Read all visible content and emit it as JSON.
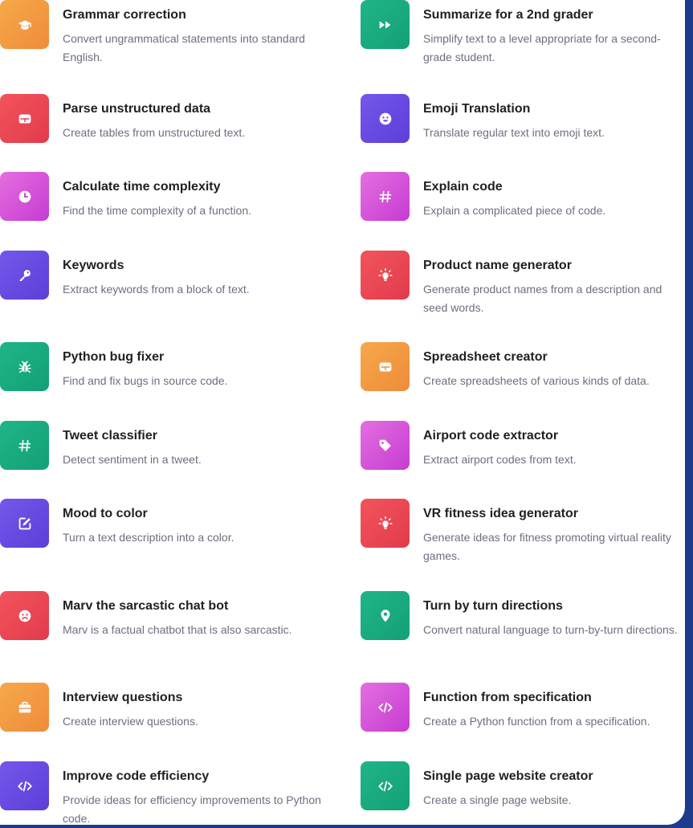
{
  "examples": [
    {
      "title": "Grammar correction",
      "desc": "Convert ungrammatical statements into standard English.",
      "icon": "graduation-cap-icon",
      "color": "#f09a43"
    },
    {
      "title": "Summarize for a 2nd grader",
      "desc": "Simplify text to a level appropriate for a second-grade student.",
      "icon": "fast-forward-icon",
      "color": "#19a97e"
    },
    {
      "title": "Parse unstructured data",
      "desc": "Create tables from unstructured text.",
      "icon": "table-icon",
      "color": "#ea4654"
    },
    {
      "title": "Emoji Translation",
      "desc": "Translate regular text into emoji text.",
      "icon": "smiley-face-icon",
      "color": "#6249df"
    },
    {
      "title": "Calculate time complexity",
      "desc": "Find the time complexity of a function.",
      "icon": "clock-icon",
      "color": "#d454d9"
    },
    {
      "title": "Explain code",
      "desc": "Explain a complicated piece of code.",
      "icon": "hashtag-icon",
      "color": "#d454d9"
    },
    {
      "title": "Keywords",
      "desc": "Extract keywords from a block of text.",
      "icon": "key-icon",
      "color": "#6249df"
    },
    {
      "title": "Product name generator",
      "desc": "Generate product names from a description and seed words.",
      "icon": "lightbulb-icon",
      "color": "#ea4654"
    },
    {
      "title": "Python bug fixer",
      "desc": "Find and fix bugs in source code.",
      "icon": "bug-icon",
      "color": "#19a97e"
    },
    {
      "title": "Spreadsheet creator",
      "desc": "Create spreadsheets of various kinds of data.",
      "icon": "table-icon",
      "color": "#f09a43"
    },
    {
      "title": "Tweet classifier",
      "desc": "Detect sentiment in a tweet.",
      "icon": "hashtag-icon",
      "color": "#19a97e"
    },
    {
      "title": "Airport code extractor",
      "desc": "Extract airport codes from text.",
      "icon": "tag-icon",
      "color": "#d454d9"
    },
    {
      "title": "Mood to color",
      "desc": "Turn a text description into a color.",
      "icon": "edit-icon",
      "color": "#6249df"
    },
    {
      "title": "VR fitness idea generator",
      "desc": "Generate ideas for fitness promoting virtual reality games.",
      "icon": "lightbulb-icon",
      "color": "#ea4654"
    },
    {
      "title": "Marv the sarcastic chat bot",
      "desc": "Marv is a factual chatbot that is also sarcastic.",
      "icon": "frown-face-icon",
      "color": "#ea4654"
    },
    {
      "title": "Turn by turn directions",
      "desc": "Convert natural language to turn-by-turn directions.",
      "icon": "map-pin-icon",
      "color": "#19a97e"
    },
    {
      "title": "Interview questions",
      "desc": "Create interview questions.",
      "icon": "briefcase-icon",
      "color": "#f09a43"
    },
    {
      "title": "Function from specification",
      "desc": "Create a Python function from a specification.",
      "icon": "code-icon",
      "color": "#d454d9"
    },
    {
      "title": "Improve code efficiency",
      "desc": "Provide ideas for efficiency improvements to Python code.",
      "icon": "code-icon",
      "color": "#6249df"
    },
    {
      "title": "Single page website creator",
      "desc": "Create a single page website.",
      "icon": "code-icon",
      "color": "#19a97e"
    }
  ]
}
